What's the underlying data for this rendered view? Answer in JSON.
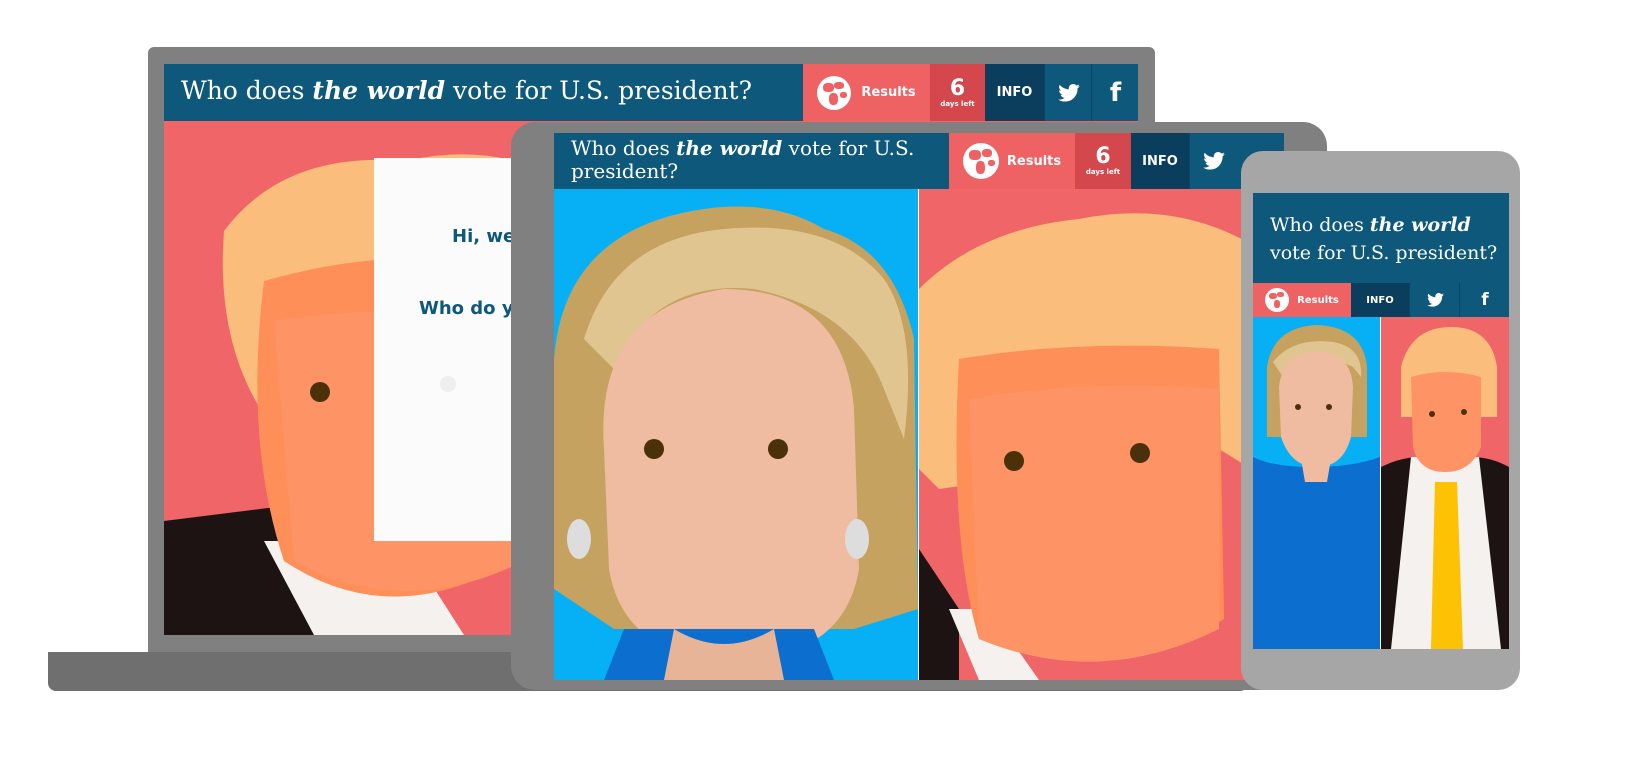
{
  "title": {
    "prefix": "Who does ",
    "emph": "the world",
    "suffix": " vote for U.S. president?"
  },
  "title_tablet": {
    "prefix": "Who does ",
    "emph": "the world",
    "line1_suffix": " vote for U.S.",
    "line2": "president?"
  },
  "title_phone": {
    "prefix": "Who does ",
    "emph": "the world",
    "line2": "vote for U.S. president?"
  },
  "nav": {
    "results_label": "Results",
    "days_count": "6",
    "days_label": "days left",
    "info_label": "INFO",
    "twitter_icon": "twitter-icon",
    "facebook_icon": "facebook-icon",
    "facebook_glyph": "f",
    "globe_icon": "globe-icon"
  },
  "modal": {
    "greeting": "Hi, we",
    "question": "Who do y"
  },
  "colors": {
    "header": "#0e587c",
    "results_bg": "#ef6264",
    "days_bg": "#d4474d",
    "info_bg": "#0b3e5c",
    "trump_bg": "#f06567",
    "clinton_bg": "#07b0f4",
    "device_gray": "#808080"
  }
}
